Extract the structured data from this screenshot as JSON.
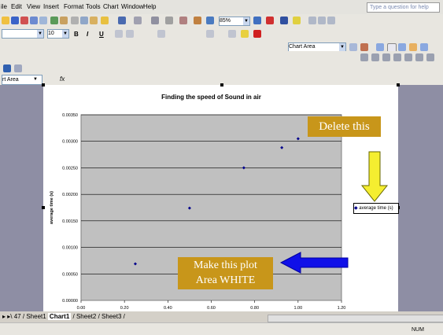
{
  "menu": {
    "items": [
      "ile",
      "Edit",
      "View",
      "Insert",
      "Format",
      "Tools",
      "Chart",
      "Window",
      "Help"
    ],
    "help_placeholder": "Type a question for help"
  },
  "toolbar": {
    "zoom": "85%",
    "font_size": "10",
    "bold": "B",
    "italic": "I",
    "underline": "U",
    "chart_object": "Chart Area",
    "name_box": "rt Area",
    "fx": "fx"
  },
  "chart_data": {
    "type": "scatter",
    "title": "Finding the speed of Sound in air",
    "ylabel": "average time (s)",
    "xlabel": "",
    "xlim": [
      0,
      1.2
    ],
    "ylim": [
      0,
      0.0035
    ],
    "x_ticks": [
      "0.00",
      "0.20",
      "0.40",
      "0.60",
      "0.80",
      "1.00",
      "1.20"
    ],
    "y_ticks": [
      "0.00000",
      "0.00050",
      "0.00100",
      "0.00150",
      "0.00200",
      "0.00250",
      "0.00300",
      "0.00350"
    ],
    "grid": "horizontal",
    "legend_position": "right",
    "series": [
      {
        "name": "average time (s)",
        "color": "#00008b",
        "x": [
          0.25,
          0.5,
          0.75,
          0.925,
          1.0
        ],
        "y": [
          0.00069,
          0.00174,
          0.0025,
          0.00288,
          0.00305
        ]
      }
    ],
    "plot_area_color": "#c0c0c0"
  },
  "annotations": {
    "delete_label": "Delete this",
    "plot_area_label_line1": "Make this plot",
    "plot_area_label_line2": "Area WHITE",
    "yellow_arrow_color": "#f5ee30",
    "blue_arrow_color": "#1010e8"
  },
  "sheet_tabs": {
    "nav": "▸ ▸\\",
    "tab0": "47",
    "tab1": "Sheet1",
    "tab2": "Chart1",
    "tab3": "Sheet2",
    "tab4": "Sheet3"
  },
  "status": {
    "num": "NUM"
  }
}
